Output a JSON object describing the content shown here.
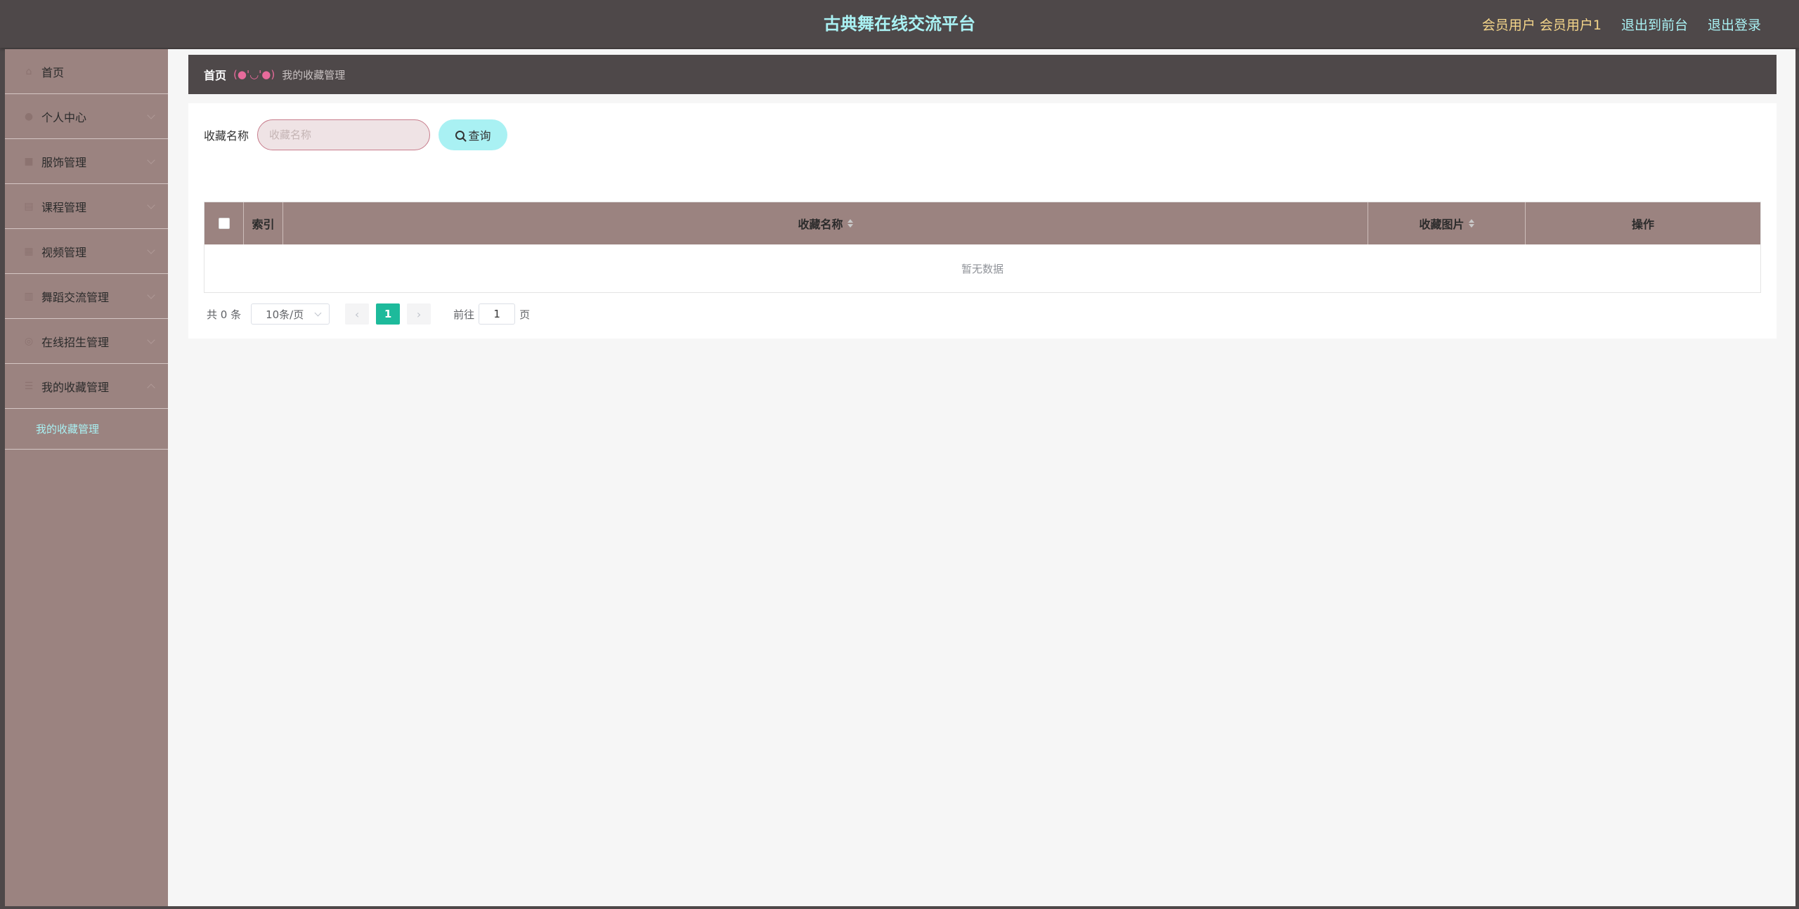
{
  "header": {
    "title": "古典舞在线交流平台",
    "user_text": "会员用户 会员用户1",
    "to_front": "退出到前台",
    "logout": "退出登录"
  },
  "sidebar": {
    "items": [
      {
        "label": "首页",
        "icon": "home-icon"
      },
      {
        "label": "个人中心",
        "icon": "user-icon"
      },
      {
        "label": "服饰管理",
        "icon": "clothing-icon"
      },
      {
        "label": "课程管理",
        "icon": "course-icon"
      },
      {
        "label": "视频管理",
        "icon": "video-icon"
      },
      {
        "label": "舞蹈交流管理",
        "icon": "forum-icon"
      },
      {
        "label": "在线招生管理",
        "icon": "enroll-icon"
      },
      {
        "label": "我的收藏管理",
        "icon": "favorite-icon"
      }
    ],
    "sub_item": "我的收藏管理"
  },
  "breadcrumb": {
    "home": "首页",
    "face": "(●'◡'●)",
    "current": "我的收藏管理"
  },
  "search": {
    "label": "收藏名称",
    "placeholder": "收藏名称",
    "button": "查询"
  },
  "table": {
    "columns": [
      "索引",
      "收藏名称",
      "收藏图片",
      "操作"
    ],
    "empty_text": "暂无数据"
  },
  "pagination": {
    "total": "共 0 条",
    "page_size": "10条/页",
    "current_page": "1",
    "goto_label": "前往",
    "goto_value": "1",
    "page_unit": "页"
  },
  "colors": {
    "topbar": "#4e4849",
    "sidebar": "#9b8380",
    "accent": "#a9f1f3",
    "active_page": "#1dba9b"
  }
}
